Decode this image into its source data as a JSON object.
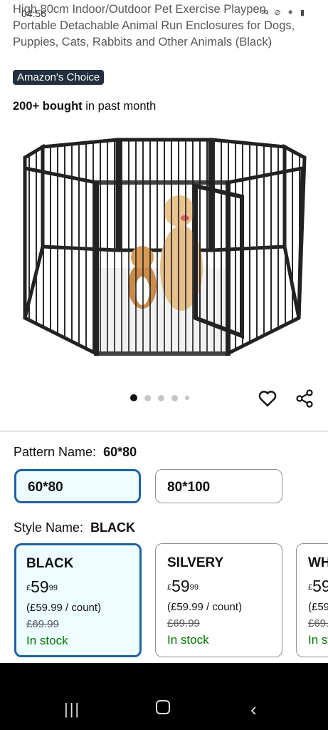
{
  "status_bar": {
    "time": "04:56",
    "icons": "✉ ⊘ ⁕ ▮"
  },
  "product": {
    "title": "High 80cm Indoor/Outdoor Pet Exercise Playpen, Portable Detachable Animal Run Enclosures for Dogs, Puppies, Cats, Rabbits and Other Animals (Black)",
    "badge": "Amazon's Choice",
    "bought_bold": "200+ bought",
    "bought_rest": " in past month"
  },
  "carousel": {
    "total_images": 5,
    "current_index": 1
  },
  "actions": {
    "wishlist_icon": "heart-icon",
    "share_icon": "share-icon"
  },
  "pattern": {
    "label": "Pattern Name:",
    "selected": "60*80",
    "options": [
      {
        "label": "60*80",
        "selected": true
      },
      {
        "label": "80*100",
        "selected": false
      }
    ]
  },
  "style": {
    "label": "Style Name:",
    "selected": "BLACK",
    "options": [
      {
        "name": "BLACK",
        "currency": "£",
        "price_whole": "59",
        "price_fraction": "99",
        "unit_price": "(£59.99 / count)",
        "was_price": "£69.99",
        "stock": "In stock",
        "selected": true
      },
      {
        "name": "SILVERY",
        "currency": "£",
        "price_whole": "59",
        "price_fraction": "99",
        "unit_price": "(£59.99 / count)",
        "was_price": "£69.99",
        "stock": "In stock",
        "selected": false
      },
      {
        "name": "WH",
        "currency": "£",
        "price_whole": "59",
        "price_fraction": "",
        "unit_price": "(£59",
        "was_price": "£69.",
        "stock": "In st",
        "selected": false
      }
    ]
  },
  "nav_bar": {
    "recent": "|||",
    "back": "‹"
  },
  "colors": {
    "accent_border": "#2162a1",
    "selected_bg": "#edfdff",
    "in_stock": "#007600",
    "badge_bg": "#232f3e"
  }
}
